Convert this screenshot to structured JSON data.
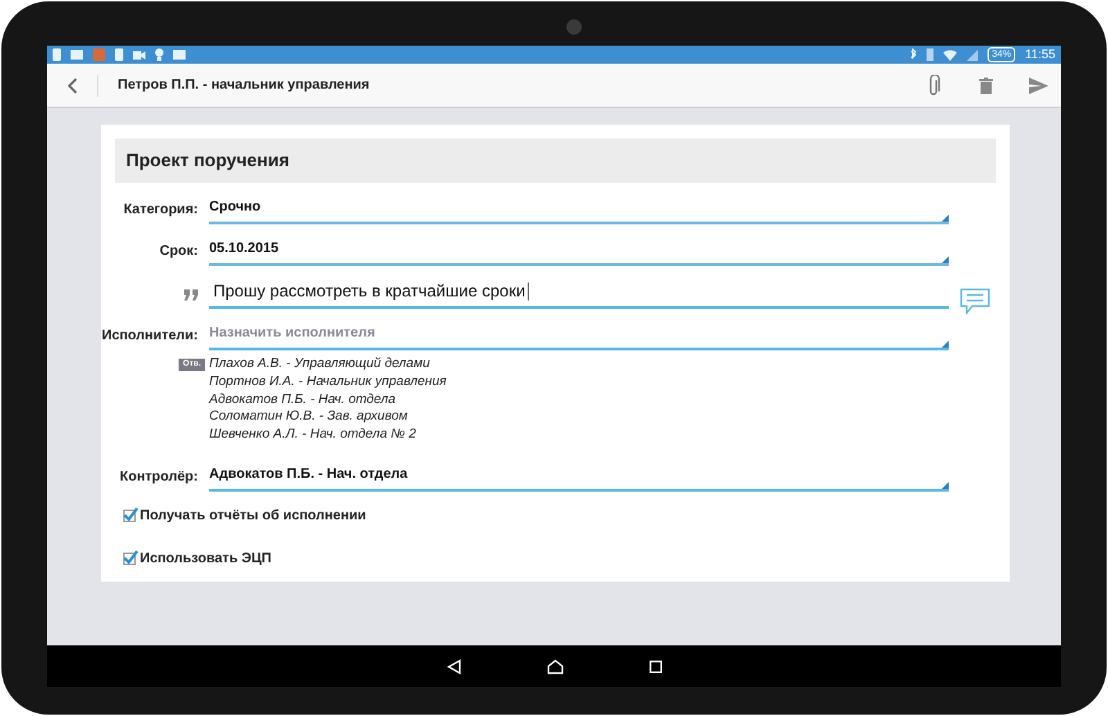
{
  "status_bar": {
    "battery": "34%",
    "time": "11:55"
  },
  "app_bar": {
    "title": "Петров П.П. - начальник управления"
  },
  "form": {
    "title": "Проект поручения",
    "fields": [
      {
        "kind": "dropdown",
        "label": "Категория:",
        "value": "Срочно"
      },
      {
        "kind": "dropdown",
        "label": "Срок:",
        "value": "05.10.2015"
      },
      {
        "kind": "comment",
        "value": "Прошу рассмотреть в кратчайшие сроки"
      }
    ],
    "executors": {
      "label": "Исполнители:",
      "placeholder": "Назначить исполнителя",
      "badge": "Отв.",
      "people": [
        "Плахов А.В. - Управляющий делами",
        "Портнов И.А. - Начальник управления",
        "Адвокатов П.Б. - Нач. отдела",
        "Соломатин Ю.В. - Зав. архивом",
        "Шевченко А.Л. - Нач. отдела № 2"
      ]
    },
    "controller": {
      "label": "Контролёр:",
      "value": "Адвокатов П.Б. - Нач. отдела"
    },
    "checkboxes": [
      {
        "label": "Получать отчёты об исполнении",
        "checked": true
      },
      {
        "label": "Использовать ЭЦП",
        "checked": true
      }
    ]
  }
}
